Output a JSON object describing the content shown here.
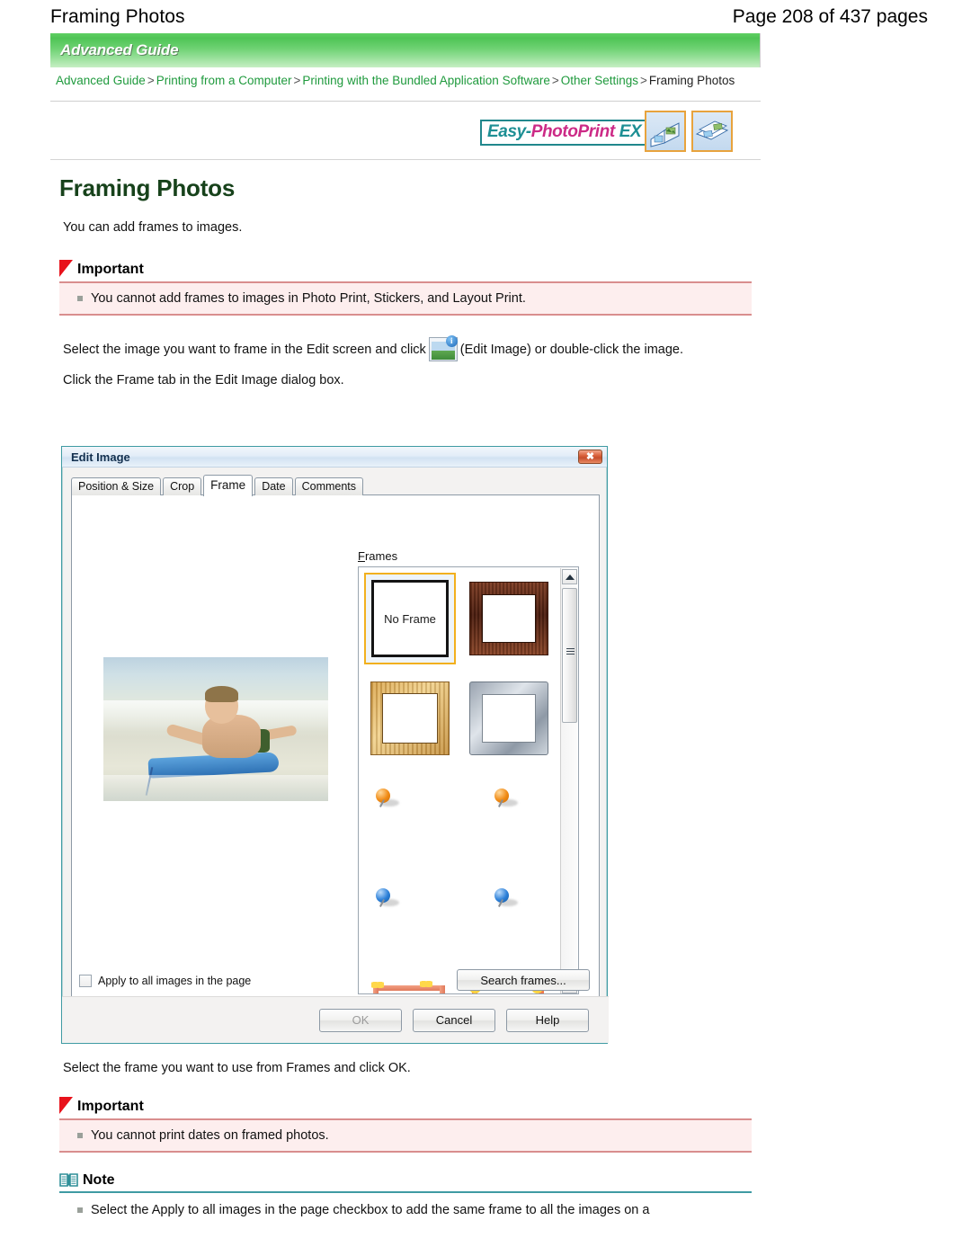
{
  "header": {
    "doc_title": "Framing Photos",
    "page_indicator": "Page 208 of 437 pages"
  },
  "guide_banner": {
    "label": "Advanced Guide"
  },
  "breadcrumb": {
    "items": [
      "Advanced Guide",
      "Printing from a Computer",
      "Printing with the Bundled Application Software",
      "Other Settings"
    ],
    "separator": ">",
    "current": "Framing Photos"
  },
  "product_logo": {
    "segment_1": "Easy-",
    "segment_2": "PhotoPrint",
    "segment_3": " EX",
    "icon_1": "photo-album-icon",
    "icon_2": "photo-layers-icon"
  },
  "page_title": "Framing Photos",
  "intro_text": "You can add frames to images.",
  "important_1": {
    "label": "Important",
    "icon": "red-flag-icon",
    "bullets": [
      "You cannot add frames to images in Photo Print, Stickers, and Layout Print."
    ]
  },
  "instructions": {
    "line1_part1": "Select the image you want to frame in the Edit screen and click",
    "inline_icon": "edit-image-icon",
    "inline_icon_badge": "i",
    "line1_part2": "(Edit Image) or double-click the image.",
    "line2": "Click the Frame tab in the Edit Image dialog box."
  },
  "dialog": {
    "title": "Edit Image",
    "close_label": "✖",
    "tabs": [
      {
        "label": "Position & Size",
        "active": false
      },
      {
        "label": "Crop",
        "active": false
      },
      {
        "label": "Frame",
        "active": true
      },
      {
        "label": "Date",
        "active": false
      },
      {
        "label": "Comments",
        "active": false
      }
    ],
    "frames_group_label_accel": "F",
    "frames_group_label_rest": "rames",
    "frames": [
      {
        "name": "No Frame",
        "caption": "No Frame",
        "selected": true
      },
      {
        "name": "dark-wood-frame",
        "caption": "",
        "selected": false
      },
      {
        "name": "light-wood-frame",
        "caption": "",
        "selected": false
      },
      {
        "name": "silver-metal-frame",
        "caption": "",
        "selected": false
      },
      {
        "name": "orange-pushpin-frame",
        "caption": "",
        "selected": false
      },
      {
        "name": "orange-pushpin-frame-2",
        "caption": "",
        "selected": false
      },
      {
        "name": "blue-pushpin-frame",
        "caption": "",
        "selected": false
      },
      {
        "name": "blue-pushpin-frame-2",
        "caption": "",
        "selected": false
      },
      {
        "name": "butterfly-flower-frame",
        "caption": "",
        "selected": false
      },
      {
        "name": "sunflower-frame",
        "caption": "",
        "selected": false
      }
    ],
    "preview_image_alt": "boy-on-bodyboard-photo",
    "apply_checkbox": {
      "label": "Apply to all images in the page",
      "checked": false
    },
    "search_frames_button": "Search frames...",
    "buttons": {
      "ok": "OK",
      "ok_disabled": true,
      "cancel": "Cancel",
      "help": "Help"
    },
    "scrollbar": {
      "up": "▲",
      "down": "▼"
    }
  },
  "after_dialog_text": "Select the frame you want to use from Frames and click OK.",
  "important_2": {
    "label": "Important",
    "icon": "red-flag-icon",
    "bullets": [
      "You cannot print dates on framed photos."
    ]
  },
  "note": {
    "label": "Note",
    "icon": "open-book-icon",
    "bullets": [
      "Select the Apply to all images in the page checkbox to add the same frame to all the images on a"
    ]
  },
  "colors": {
    "banner_green": "#4fc455",
    "link_green": "#1f9a3d",
    "title_green": "#17421b",
    "important_bg": "#fdeeee",
    "important_rule": "#d98e8e",
    "note_rule": "#3f9ba3",
    "dialog_border": "#3f9ba3",
    "selection_outline": "#f2b01e"
  }
}
